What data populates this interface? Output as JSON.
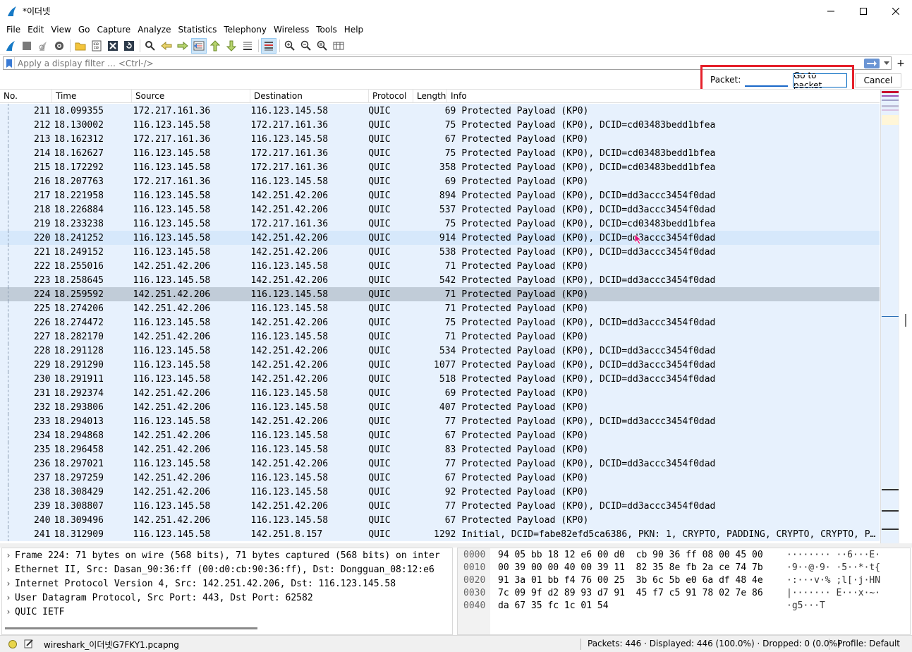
{
  "window": {
    "title": "*이더넷"
  },
  "menu": [
    "File",
    "Edit",
    "View",
    "Go",
    "Capture",
    "Analyze",
    "Statistics",
    "Telephony",
    "Wireless",
    "Tools",
    "Help"
  ],
  "filter": {
    "placeholder": "Apply a display filter … <Ctrl-/>"
  },
  "goto": {
    "label": "Packet:",
    "value": "",
    "go_button": "Go to packet",
    "cancel_button": "Cancel"
  },
  "columns": [
    "No.",
    "Time",
    "Source",
    "Destination",
    "Protocol",
    "Length",
    "Info"
  ],
  "packets": [
    [
      "211",
      "18.099355",
      "172.217.161.36",
      "116.123.145.58",
      "QUIC",
      "69",
      "Protected Payload (KP0)"
    ],
    [
      "212",
      "18.130002",
      "116.123.145.58",
      "172.217.161.36",
      "QUIC",
      "75",
      "Protected Payload (KP0), DCID=cd03483bedd1bfea"
    ],
    [
      "213",
      "18.162312",
      "172.217.161.36",
      "116.123.145.58",
      "QUIC",
      "67",
      "Protected Payload (KP0)"
    ],
    [
      "214",
      "18.162627",
      "116.123.145.58",
      "172.217.161.36",
      "QUIC",
      "75",
      "Protected Payload (KP0), DCID=cd03483bedd1bfea"
    ],
    [
      "215",
      "18.172292",
      "116.123.145.58",
      "172.217.161.36",
      "QUIC",
      "358",
      "Protected Payload (KP0), DCID=cd03483bedd1bfea"
    ],
    [
      "216",
      "18.207763",
      "172.217.161.36",
      "116.123.145.58",
      "QUIC",
      "69",
      "Protected Payload (KP0)"
    ],
    [
      "217",
      "18.221958",
      "116.123.145.58",
      "142.251.42.206",
      "QUIC",
      "894",
      "Protected Payload (KP0), DCID=dd3accc3454f0dad"
    ],
    [
      "218",
      "18.226884",
      "116.123.145.58",
      "142.251.42.206",
      "QUIC",
      "537",
      "Protected Payload (KP0), DCID=dd3accc3454f0dad"
    ],
    [
      "219",
      "18.233238",
      "116.123.145.58",
      "172.217.161.36",
      "QUIC",
      "75",
      "Protected Payload (KP0), DCID=cd03483bedd1bfea"
    ],
    [
      "220",
      "18.241252",
      "116.123.145.58",
      "142.251.42.206",
      "QUIC",
      "914",
      "Protected Payload (KP0), DCID=dd3accc3454f0dad"
    ],
    [
      "221",
      "18.249152",
      "116.123.145.58",
      "142.251.42.206",
      "QUIC",
      "538",
      "Protected Payload (KP0), DCID=dd3accc3454f0dad"
    ],
    [
      "222",
      "18.255016",
      "142.251.42.206",
      "116.123.145.58",
      "QUIC",
      "71",
      "Protected Payload (KP0)"
    ],
    [
      "223",
      "18.258645",
      "116.123.145.58",
      "142.251.42.206",
      "QUIC",
      "542",
      "Protected Payload (KP0), DCID=dd3accc3454f0dad"
    ],
    [
      "224",
      "18.259592",
      "142.251.42.206",
      "116.123.145.58",
      "QUIC",
      "71",
      "Protected Payload (KP0)"
    ],
    [
      "225",
      "18.274206",
      "142.251.42.206",
      "116.123.145.58",
      "QUIC",
      "71",
      "Protected Payload (KP0)"
    ],
    [
      "226",
      "18.274472",
      "116.123.145.58",
      "142.251.42.206",
      "QUIC",
      "75",
      "Protected Payload (KP0), DCID=dd3accc3454f0dad"
    ],
    [
      "227",
      "18.282170",
      "142.251.42.206",
      "116.123.145.58",
      "QUIC",
      "71",
      "Protected Payload (KP0)"
    ],
    [
      "228",
      "18.291128",
      "116.123.145.58",
      "142.251.42.206",
      "QUIC",
      "534",
      "Protected Payload (KP0), DCID=dd3accc3454f0dad"
    ],
    [
      "229",
      "18.291290",
      "116.123.145.58",
      "142.251.42.206",
      "QUIC",
      "1077",
      "Protected Payload (KP0), DCID=dd3accc3454f0dad"
    ],
    [
      "230",
      "18.291911",
      "116.123.145.58",
      "142.251.42.206",
      "QUIC",
      "518",
      "Protected Payload (KP0), DCID=dd3accc3454f0dad"
    ],
    [
      "231",
      "18.292374",
      "142.251.42.206",
      "116.123.145.58",
      "QUIC",
      "69",
      "Protected Payload (KP0)"
    ],
    [
      "232",
      "18.293806",
      "142.251.42.206",
      "116.123.145.58",
      "QUIC",
      "407",
      "Protected Payload (KP0)"
    ],
    [
      "233",
      "18.294013",
      "116.123.145.58",
      "142.251.42.206",
      "QUIC",
      "77",
      "Protected Payload (KP0), DCID=dd3accc3454f0dad"
    ],
    [
      "234",
      "18.294868",
      "142.251.42.206",
      "116.123.145.58",
      "QUIC",
      "67",
      "Protected Payload (KP0)"
    ],
    [
      "235",
      "18.296458",
      "142.251.42.206",
      "116.123.145.58",
      "QUIC",
      "83",
      "Protected Payload (KP0)"
    ],
    [
      "236",
      "18.297021",
      "116.123.145.58",
      "142.251.42.206",
      "QUIC",
      "77",
      "Protected Payload (KP0), DCID=dd3accc3454f0dad"
    ],
    [
      "237",
      "18.297259",
      "142.251.42.206",
      "116.123.145.58",
      "QUIC",
      "67",
      "Protected Payload (KP0)"
    ],
    [
      "238",
      "18.308429",
      "142.251.42.206",
      "116.123.145.58",
      "QUIC",
      "92",
      "Protected Payload (KP0)"
    ],
    [
      "239",
      "18.308807",
      "116.123.145.58",
      "142.251.42.206",
      "QUIC",
      "77",
      "Protected Payload (KP0), DCID=dd3accc3454f0dad"
    ],
    [
      "240",
      "18.309496",
      "142.251.42.206",
      "116.123.145.58",
      "QUIC",
      "67",
      "Protected Payload (KP0)"
    ],
    [
      "241",
      "18.312909",
      "116.123.145.58",
      "142.251.8.157",
      "QUIC",
      "1292",
      "Initial, DCID=fabe82efd5ca6386, PKN: 1, CRYPTO, PADDING, CRYPTO, CRYPTO, P…"
    ]
  ],
  "selected_packet": "224",
  "details": [
    "Frame 224: 71 bytes on wire (568 bits), 71 bytes captured (568 bits) on inter",
    "Ethernet II, Src: Dasan_90:36:ff (00:d0:cb:90:36:ff), Dst: Dongguan_08:12:e6",
    "Internet Protocol Version 4, Src: 142.251.42.206, Dst: 116.123.145.58",
    "User Datagram Protocol, Src Port: 443, Dst Port: 62582",
    "QUIC IETF"
  ],
  "bytes": [
    {
      "off": "0000",
      "hex": "94 05 bb 18 12 e6 00 d0  cb 90 36 ff 08 00 45 00",
      "ascii": "········ ··6···E·"
    },
    {
      "off": "0010",
      "hex": "00 39 00 00 40 00 39 11  82 35 8e fb 2a ce 74 7b",
      "ascii": "·9··@·9· ·5··*·t{"
    },
    {
      "off": "0020",
      "hex": "91 3a 01 bb f4 76 00 25  3b 6c 5b e0 6a df 48 4e",
      "ascii": "·:···v·% ;l[·j·HN"
    },
    {
      "off": "0030",
      "hex": "7c 09 9f d2 89 93 d7 91  45 f7 c5 91 78 02 7e 86",
      "ascii": "|······· E···x·~·"
    },
    {
      "off": "0040",
      "hex": "da 67 35 fc 1c 01 54",
      "ascii": "·g5···T"
    }
  ],
  "status": {
    "file": "wireshark_이더넷G7FKY1.pcapng",
    "packets": "Packets: 446 · Displayed: 446 (100.0%) · Dropped: 0 (0.0%)",
    "profile": "Profile: Default"
  },
  "colors": {
    "row_bg": "#e7f1fd",
    "selected_bg": "#c1ccd8",
    "highlight_box": "#e5202a",
    "accent": "#0067c0"
  }
}
